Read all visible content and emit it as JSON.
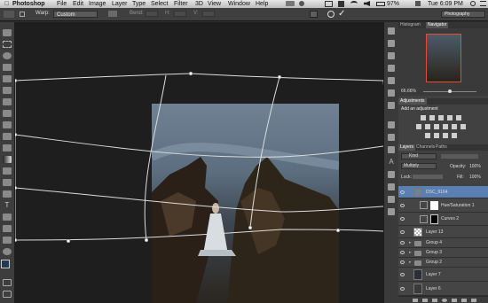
{
  "menubar": {
    "app_name": "Photoshop",
    "menus": [
      "File",
      "Edit",
      "Image",
      "Layer",
      "Type",
      "Select",
      "Filter",
      "3D",
      "View",
      "Window",
      "Help"
    ],
    "battery": "97%",
    "clock": "Tue 6:09 PM"
  },
  "options": {
    "warp_label": "Warp:",
    "warp_value": "Custom",
    "bend_label": "Bend:"
  },
  "workspace": {
    "name": "Photography"
  },
  "navigator": {
    "tabs": [
      "Histogram",
      "Navigator"
    ],
    "zoom": "66.66%"
  },
  "adjustments": {
    "tabs": [
      "Adjustments"
    ],
    "add_label": "Add an adjustment"
  },
  "layers_panel": {
    "tabs": [
      "Layers",
      "Channels",
      "Paths"
    ],
    "kind_filter": "Kind",
    "blend_mode": "Multiply",
    "opacity_label": "Opacity:",
    "opacity_value": "100%",
    "lock_label": "Lock:",
    "fill_label": "Fill:",
    "fill_value": "100%",
    "layers": [
      {
        "name": "DSC_9164"
      },
      {
        "name": "Hue/Saturation 1"
      },
      {
        "name": "Curves 2"
      },
      {
        "name": "Layer 13"
      },
      {
        "name": "Group 4"
      },
      {
        "name": "Group 3"
      },
      {
        "name": "Group 2"
      },
      {
        "name": "Layer 7"
      },
      {
        "name": "Layer 6"
      }
    ]
  },
  "colors": {
    "menubar_bg": "#d4d4d4",
    "panel_bg": "#414141",
    "canvas_bg": "#1e1e1e",
    "selected_layer": "#5a7fb3"
  }
}
